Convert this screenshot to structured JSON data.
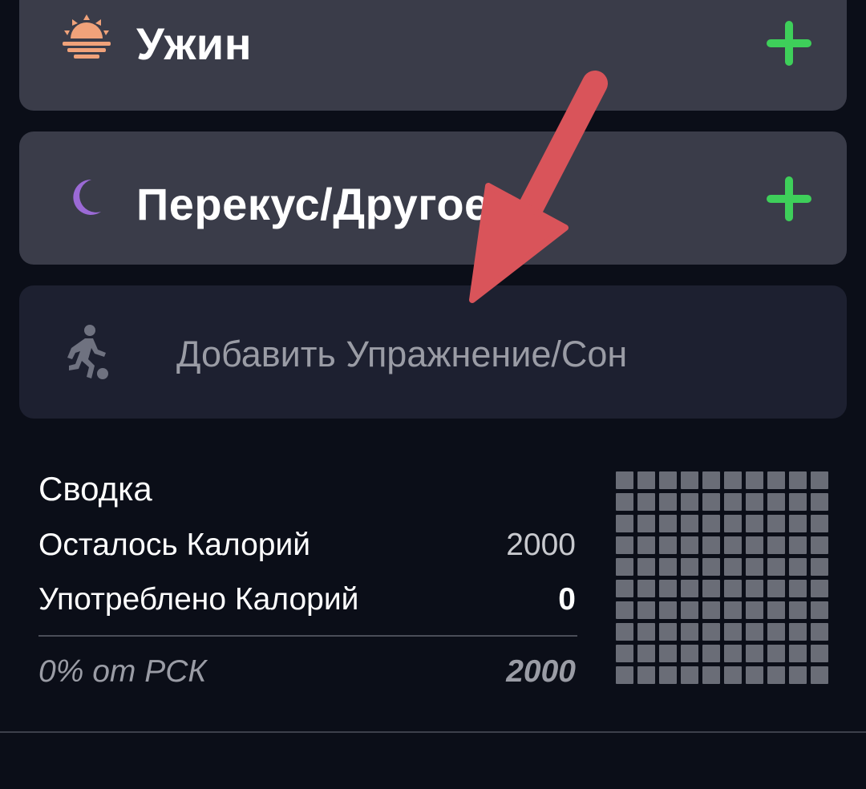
{
  "meals": [
    {
      "label": "Ужин",
      "icon": "sunset-icon",
      "add_icon": "plus-icon"
    },
    {
      "label": "Перекус/Другое",
      "icon": "moon-icon",
      "add_icon": "plus-icon"
    }
  ],
  "exercise": {
    "label": "Добавить Упражнение/Сон",
    "icon": "running-person-icon"
  },
  "summary": {
    "title": "Сводка",
    "remaining_label": "Осталось Калорий",
    "remaining_value": "2000",
    "consumed_label": "Употреблено Калорий",
    "consumed_value": "0",
    "percent_label": "0% от РСК",
    "target_value": "2000",
    "grid_fill_fraction": 0
  },
  "colors": {
    "accent_green": "#3ecf5a",
    "card_bg": "#3a3c49",
    "background": "#0b0e18",
    "annotation_arrow": "#d9545a",
    "sunset_orange": "#f0a27a",
    "moon_purple": "#9b6ad6"
  }
}
